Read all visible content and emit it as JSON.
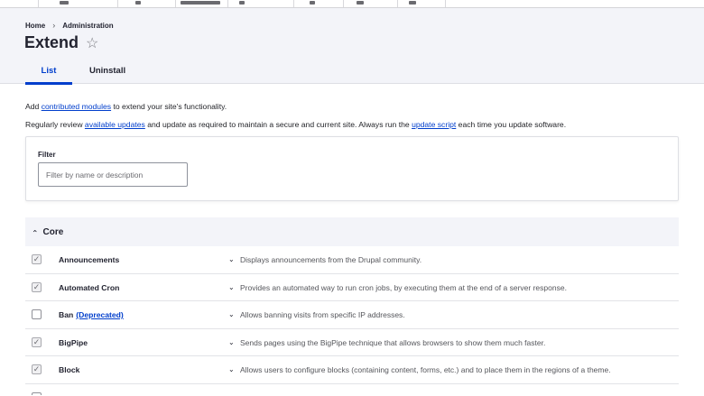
{
  "breadcrumb": {
    "home": "Home",
    "separator": "›",
    "admin": "Administration"
  },
  "page": {
    "title": "Extend",
    "star_icon": "☆"
  },
  "tabs": {
    "list": "List",
    "uninstall": "Uninstall"
  },
  "intro": {
    "line1_pre": "Add ",
    "line1_link": "contributed modules",
    "line1_post": " to extend your site's functionality.",
    "line2_pre": "Regularly review ",
    "line2_link1": "available updates",
    "line2_mid": " and update as required to maintain a secure and current site. Always run the ",
    "line2_link2": "update script",
    "line2_post": " each time you update software."
  },
  "filter": {
    "label": "Filter",
    "placeholder": "Filter by name or description",
    "value": ""
  },
  "core": {
    "label": "Core"
  },
  "modules": [
    {
      "name": "Announcements",
      "checked": true,
      "description": "Displays announcements from the Drupal community."
    },
    {
      "name": "Automated Cron",
      "checked": true,
      "description": "Provides an automated way to run cron jobs, by executing them at the end of a server response."
    },
    {
      "name": "Ban",
      "deprecated": "(Deprecated)",
      "checked": false,
      "description": "Allows banning visits from specific IP addresses."
    },
    {
      "name": "BigPipe",
      "checked": true,
      "description": "Sends pages using the BigPipe technique that allows browsers to show them much faster."
    },
    {
      "name": "Block",
      "checked": true,
      "description": "Allows users to configure blocks (containing content, forms, etc.) and to place them in the regions of a theme."
    }
  ],
  "colors": {
    "link": "#003ecc",
    "header_bg": "#f3f4f9"
  }
}
